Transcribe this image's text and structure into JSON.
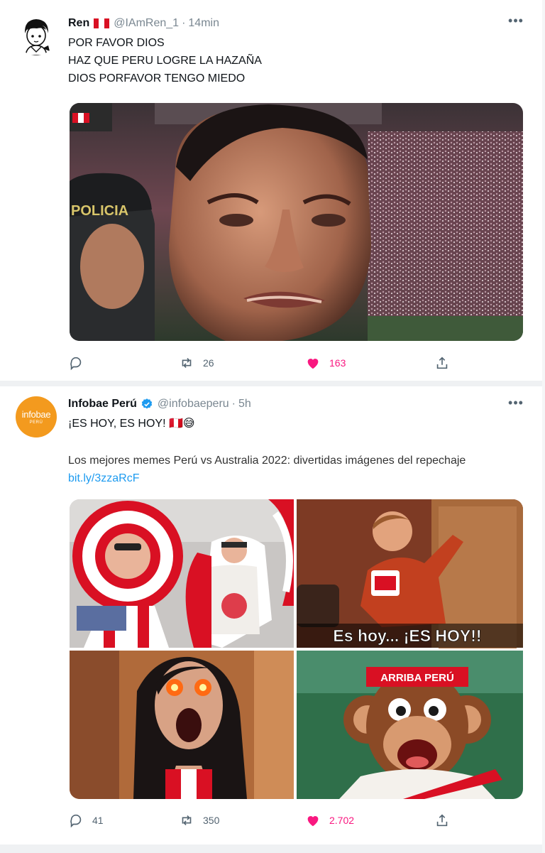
{
  "tweets": [
    {
      "author": {
        "name": "Ren",
        "handle": "@IAmRen_1",
        "time": "14min"
      },
      "lines": [
        "POR FAVOR DIOS",
        "HAZ QUE PERU LOGRE LA HAZAÑA",
        "DIOS PORFAVOR TENGO MIEDO"
      ],
      "media": {
        "badge_text": "POLICIA"
      },
      "stats": {
        "replies": "",
        "retweets": "26",
        "likes": "163"
      }
    },
    {
      "author": {
        "name": "Infobae Perú",
        "handle": "@infobaeperu",
        "time": "5h",
        "avatar_text": "infobae",
        "avatar_subtext": "PERÚ"
      },
      "line1": "¡ES HOY, ES HOY! 🇵🇪😅",
      "line2": "Los mejores memes Perú vs Australia 2022: divertidas imágenes del repechaje",
      "link": "bit.ly/3zzaRcF",
      "media": {
        "caption": "Es hoy... ¡ES HOY!!",
        "headband_text": "ARRIBA PERÚ"
      },
      "stats": {
        "replies": "41",
        "retweets": "350",
        "likes": "2.702"
      }
    }
  ],
  "ui": {
    "separator": "·",
    "more_label": "•••"
  },
  "colors": {
    "like": "#f91880",
    "link": "#1d9bf0",
    "muted": "#536471",
    "infobae_orange": "#f39a1e",
    "peru_red": "#d91023"
  },
  "icons": [
    "reply-icon",
    "retweet-icon",
    "like-icon",
    "share-icon",
    "verified-icon",
    "more-icon"
  ]
}
